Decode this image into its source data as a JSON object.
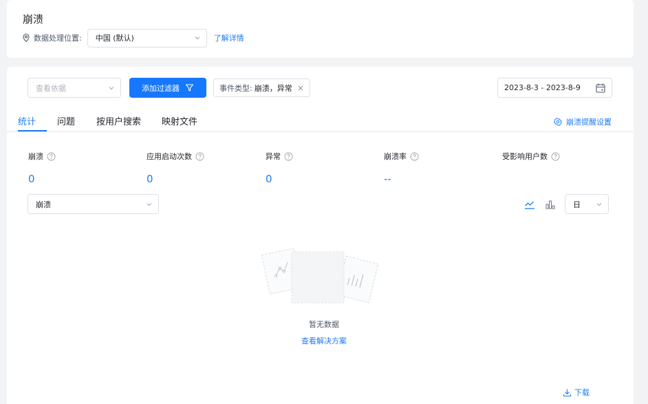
{
  "header": {
    "title": "崩溃",
    "location_label": "数据处理位置:",
    "location_value": "中国 (默认)",
    "learn_more": "了解详情"
  },
  "filters": {
    "basis_placeholder": "查看依据",
    "add_filter": "添加过滤器",
    "tag_key": "事件类型:",
    "tag_value": "崩溃，异常",
    "date_range": "2023-8-3 - 2023-8-9"
  },
  "tabs": [
    {
      "label": "统计",
      "active": true
    },
    {
      "label": "问题",
      "active": false
    },
    {
      "label": "按用户搜索",
      "active": false
    },
    {
      "label": "映射文件",
      "active": false
    }
  ],
  "alert_settings": "崩溃提醒设置",
  "metrics": [
    {
      "label": "崩溃",
      "value": "0"
    },
    {
      "label": "应用启动次数",
      "value": "0"
    },
    {
      "label": "异常",
      "value": "0"
    },
    {
      "label": "崩溃率",
      "value": "--"
    },
    {
      "label": "受影响用户数",
      "value": ""
    }
  ],
  "chart_controls": {
    "type_select": "崩溃",
    "granularity": "日"
  },
  "empty_state": {
    "text": "暂无数据",
    "link": "查看解决方案"
  },
  "download": "下载",
  "colors": {
    "accent": "#1677ff",
    "link": "#1e7bf5",
    "background": "#f2f3f5"
  },
  "icons": [
    "location-pin-icon",
    "chevron-down-icon",
    "filter-icon",
    "close-icon",
    "calendar-icon",
    "gear-icon",
    "help-icon",
    "line-chart-icon",
    "bar-chart-icon",
    "download-icon"
  ]
}
